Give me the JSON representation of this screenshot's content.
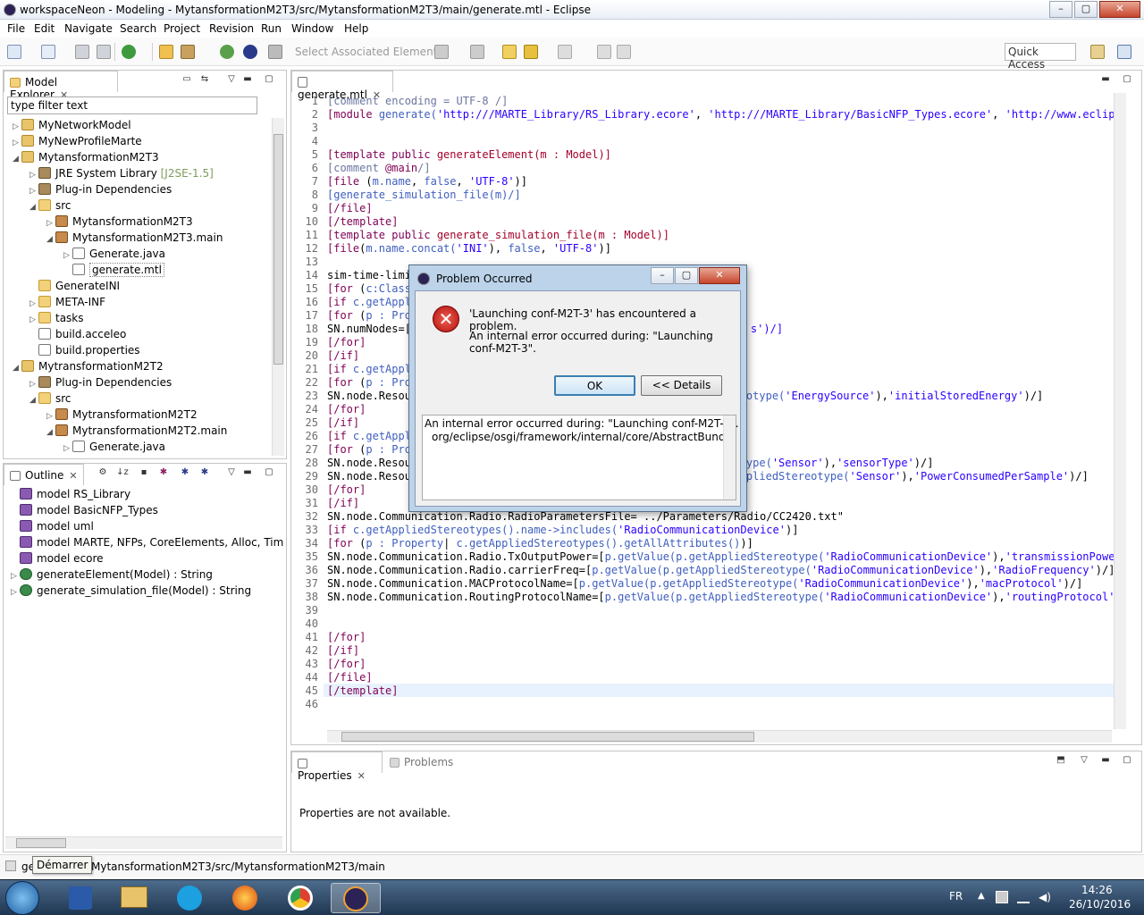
{
  "window": {
    "title": "workspaceNeon - Modeling - MytansformationM2T3/src/MytansformationM2T3/main/generate.mtl - Eclipse",
    "min": "–",
    "max": "▢",
    "close": "✕"
  },
  "menu": [
    "File",
    "Edit",
    "Navigate",
    "Search",
    "Project",
    "Revision",
    "Run",
    "Window",
    "Help"
  ],
  "toolbar": {
    "select_associated": "Select Associated Elements",
    "quick_access": "Quick Access"
  },
  "model_explorer": {
    "title": "Model Explorer",
    "filter_value": "type filter text",
    "items": [
      {
        "label": "MyNetworkModel",
        "extra": ""
      },
      {
        "label": "MyNewProfileMarte",
        "extra": ""
      },
      {
        "label": "MytansformationM2T3",
        "extra": ""
      },
      {
        "label": "JRE System Library",
        "extra": "[J2SE-1.5]"
      },
      {
        "label": "Plug-in Dependencies",
        "extra": ""
      },
      {
        "label": "src",
        "extra": ""
      },
      {
        "label": "MytansformationM2T3",
        "extra": ""
      },
      {
        "label": "MytansformationM2T3.main",
        "extra": ""
      },
      {
        "label": "Generate.java",
        "extra": ""
      },
      {
        "label": "generate.mtl",
        "extra": ""
      },
      {
        "label": "GenerateINI",
        "extra": ""
      },
      {
        "label": "META-INF",
        "extra": ""
      },
      {
        "label": "tasks",
        "extra": ""
      },
      {
        "label": "build.acceleo",
        "extra": ""
      },
      {
        "label": "build.properties",
        "extra": ""
      },
      {
        "label": "MytransformationM2T2",
        "extra": ""
      },
      {
        "label": "Plug-in Dependencies",
        "extra": ""
      },
      {
        "label": "src",
        "extra": ""
      },
      {
        "label": "MytransformationM2T2",
        "extra": ""
      },
      {
        "label": "MytransformationM2T2.main",
        "extra": ""
      },
      {
        "label": "Generate.java",
        "extra": ""
      }
    ]
  },
  "outline": {
    "title": "Outline",
    "items": [
      "model RS_Library",
      "model BasicNFP_Types",
      "model uml",
      "model MARTE, NFPs, CoreElements, Alloc, Time, G",
      "model ecore",
      "generateElement(Model) : String",
      "generate_simulation_file(Model) : String"
    ]
  },
  "editor": {
    "tab": "generate.mtl",
    "line_numbers": [
      "1",
      "2",
      "3",
      "4",
      "5",
      "6",
      "7",
      "8",
      "9",
      "10",
      "11",
      "12",
      "13",
      "14",
      "15",
      "16",
      "17",
      "18",
      "19",
      "20",
      "21",
      "22",
      "23",
      "24",
      "25",
      "26",
      "27",
      "28",
      "29",
      "30",
      "31",
      "32",
      "33",
      "34",
      "35",
      "36",
      "37",
      "38",
      "39",
      "40",
      "41",
      "42",
      "43",
      "44",
      "45",
      "46"
    ]
  },
  "properties": {
    "tab": "Properties",
    "problems_tab": "Problems",
    "message": "Properties are not available."
  },
  "dialog": {
    "title": "Problem Occurred",
    "headline": "'Launching conf-M2T-3' has encountered a problem.",
    "detail_line1": "An internal error occurred during: \"Launching",
    "detail_line2": "conf-M2T-3\".",
    "ok": "OK",
    "details": "<< Details",
    "details_text1": "An internal error occurred during: \"Launching conf-M2T-3\".",
    "details_text2": "org/eclipse/osgi/framework/internal/core/AbstractBundle"
  },
  "statusbar": {
    "path": "MytansformationM2T3/src/MytansformationM2T3/main",
    "prefix": "ge",
    "tooltip": "Démarrer"
  },
  "taskbar": {
    "lang": "FR",
    "time": "14:26",
    "date": "26/10/2016"
  }
}
